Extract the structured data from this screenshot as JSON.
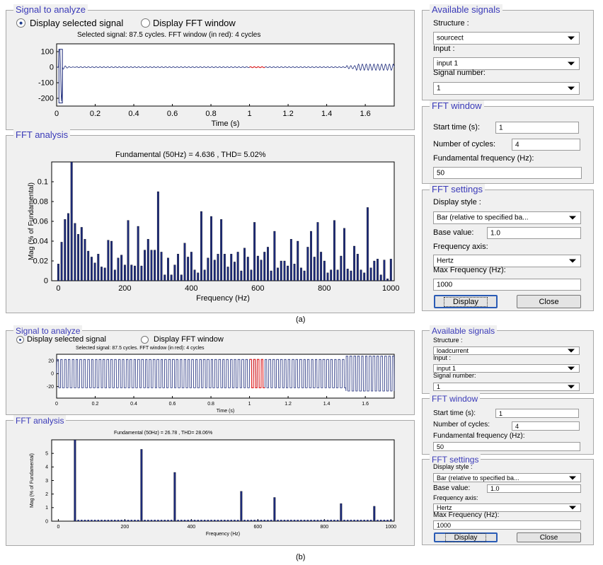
{
  "caption_a": "(a)",
  "caption_b": "(b)",
  "panels": [
    {
      "signal_group_title": "Signal to analyze",
      "radio_selected_label": "Display selected signal",
      "radio_fft_label": "Display FFT window",
      "signal_info": "Selected signal: 87.5 cycles. FFT window (in red): 4 cycles",
      "signal_plot": {
        "x_ticks": [
          "0",
          "0.2",
          "0.4",
          "0.6",
          "0.8",
          "1",
          "1.2",
          "1.4",
          "1.6"
        ],
        "y_ticks": [
          "100",
          "0",
          "-100",
          "-200"
        ],
        "xlabel": "Time (s)"
      },
      "fft_group_title": "FFT analysis",
      "fft_plot_title": "Fundamental (50Hz) = 4.636 , THD= 5.02%",
      "fft_plot": {
        "x_ticks": [
          "0",
          "200",
          "400",
          "600",
          "800",
          "1000"
        ],
        "y_ticks": [
          "0.1",
          "0.08",
          "0.06",
          "0.04",
          "0.02",
          "0"
        ],
        "xlabel": "Frequency (Hz)",
        "ylabel": "Mag (% of Fundamental)"
      },
      "available_title": "Available signals",
      "structure_label": "Structure :",
      "structure_value": "sourcect",
      "input_label": "Input :",
      "input_value": "input 1",
      "signal_number_label": "Signal number:",
      "signal_number_value": "1",
      "fft_window_title": "FFT window",
      "start_time_label": "Start time (s):",
      "start_time_value": "1",
      "cycles_label": "Number of cycles:",
      "cycles_value": "4",
      "fund_freq_label": "Fundamental frequency (Hz):",
      "fund_freq_value": "50",
      "fft_settings_title": "FFT settings",
      "display_style_label": "Display style :",
      "display_style_value": "Bar (relative to specified ba...",
      "base_value_label": "Base value:",
      "base_value_value": "1.0",
      "freq_axis_label": "Frequency axis:",
      "freq_axis_value": "Hertz",
      "max_freq_label": "Max Frequency (Hz):",
      "max_freq_value": "1000",
      "display_button": "Display",
      "close_button": "Close"
    },
    {
      "signal_group_title": "Signal to analyze",
      "radio_selected_label": "Display selected signal",
      "radio_fft_label": "Display FFT window",
      "signal_info": "Selected signal: 87.5 cycles. FFT window (in red): 4 cycles",
      "signal_plot": {
        "x_ticks": [
          "0",
          "0.2",
          "0.4",
          "0.6",
          "0.8",
          "1",
          "1.2",
          "1.4",
          "1.6"
        ],
        "y_ticks": [
          "20",
          "0",
          "-20"
        ],
        "xlabel": "Time (s)"
      },
      "fft_group_title": "FFT analysis",
      "fft_plot_title": "Fundamental (50Hz) = 26.78 , THD= 28.06%",
      "fft_plot": {
        "x_ticks": [
          "0",
          "200",
          "400",
          "600",
          "800",
          "1000"
        ],
        "y_ticks": [
          "5",
          "4",
          "3",
          "2",
          "1",
          "0"
        ],
        "xlabel": "Frequency (Hz)",
        "ylabel": "Mag (% of Fundamental)"
      },
      "available_title": "Available signals",
      "structure_label": "Structure :",
      "structure_value": "loadcurrent",
      "input_label": "Input :",
      "input_value": "input 1",
      "signal_number_label": "Signal number:",
      "signal_number_value": "1",
      "fft_window_title": "FFT window",
      "start_time_label": "Start time (s):",
      "start_time_value": "1",
      "cycles_label": "Number of cycles:",
      "cycles_value": "4",
      "fund_freq_label": "Fundamental frequency (Hz):",
      "fund_freq_value": "50",
      "fft_settings_title": "FFT settings",
      "display_style_label": "Display style :",
      "display_style_value": "Bar (relative to specified ba...",
      "base_value_label": "Base value:",
      "base_value_value": "1.0",
      "freq_axis_label": "Frequency axis:",
      "freq_axis_value": "Hertz",
      "max_freq_label": "Max Frequency (Hz):",
      "max_freq_value": "1000",
      "display_button": "Display",
      "close_button": "Close"
    }
  ],
  "chart_data": [
    {
      "type": "line",
      "title": "",
      "xlabel": "Time (s)",
      "ylabel": "",
      "xlim": [
        0,
        1.75
      ],
      "ylim": [
        -250,
        150
      ],
      "series": [
        {
          "color": "#1c2a7a",
          "x": [
            0,
            0.03,
            0.06,
            0.1,
            1.0,
            1.5,
            1.55,
            1.75
          ],
          "y": [
            0,
            110,
            0,
            3,
            2,
            5,
            20,
            15
          ]
        },
        {
          "color": "#e02020",
          "x": [
            1.0,
            1.08
          ],
          "y": [
            2,
            2
          ]
        }
      ]
    },
    {
      "type": "bar",
      "title": "Fundamental (50Hz) = 4.636 , THD= 5.02%",
      "xlabel": "Frequency (Hz)",
      "ylabel": "Mag (% of Fundamental)",
      "xlim": [
        -20,
        1010
      ],
      "ylim": [
        0,
        0.12
      ],
      "x": [
        0,
        10,
        20,
        30,
        40,
        50,
        60,
        70,
        80,
        90,
        100,
        110,
        120,
        130,
        140,
        150,
        160,
        170,
        180,
        190,
        200,
        210,
        220,
        230,
        240,
        250,
        260,
        270,
        280,
        290,
        300,
        310,
        320,
        330,
        340,
        350,
        360,
        370,
        380,
        390,
        400,
        410,
        420,
        430,
        440,
        450,
        460,
        470,
        480,
        490,
        500,
        510,
        520,
        530,
        540,
        550,
        560,
        570,
        580,
        590,
        600,
        610,
        620,
        630,
        640,
        650,
        660,
        670,
        680,
        690,
        700,
        710,
        720,
        730,
        740,
        750,
        760,
        770,
        780,
        790,
        800,
        810,
        820,
        830,
        840,
        850,
        860,
        870,
        880,
        890,
        900,
        910,
        920,
        930,
        940,
        950,
        960,
        970,
        980,
        990,
        1000
      ],
      "values": [
        0.017,
        0.039,
        0.062,
        0.068,
        0.12,
        0.058,
        0.047,
        0.054,
        0.042,
        0.03,
        0.024,
        0.018,
        0.027,
        0.014,
        0.013,
        0.041,
        0.04,
        0.011,
        0.023,
        0.026,
        0.016,
        0.061,
        0.016,
        0.015,
        0.055,
        0.015,
        0.031,
        0.042,
        0.031,
        0.031,
        0.09,
        0.029,
        0.006,
        0.023,
        0.006,
        0.016,
        0.027,
        0.006,
        0.038,
        0.024,
        0.029,
        0.011,
        0.008,
        0.07,
        0.011,
        0.023,
        0.065,
        0.021,
        0.027,
        0.062,
        0.027,
        0.014,
        0.027,
        0.019,
        0.029,
        0.01,
        0.033,
        0.024,
        0.011,
        0.059,
        0.025,
        0.021,
        0.029,
        0.034,
        0.01,
        0.05,
        0.013,
        0.02,
        0.02,
        0.015,
        0.042,
        0.017,
        0.04,
        0.013,
        0.01,
        0.034,
        0.05,
        0.024,
        0.059,
        0.029,
        0.02,
        0.008,
        0.011,
        0.061,
        0.011,
        0.025,
        0.053,
        0.012,
        0.01,
        0.035,
        0.027,
        0.011,
        0.008,
        0.074,
        0.013,
        0.02,
        0.022,
        0.006,
        0.021,
        0.002,
        0.022
      ],
      "color": "#1c2a7a"
    },
    {
      "type": "line",
      "title": "",
      "xlabel": "Time (s)",
      "ylabel": "",
      "xlim": [
        0,
        1.75
      ],
      "ylim": [
        -38,
        30
      ],
      "series": [
        {
          "color": "#1c2a7a",
          "x": [
            0,
            1.75
          ],
          "y": [
            -20,
            20
          ]
        },
        {
          "color": "#e02020",
          "x": [
            1.0,
            1.08
          ],
          "y": [
            -20,
            20
          ]
        }
      ]
    },
    {
      "type": "bar",
      "title": "Fundamental (50Hz) = 26.78 , THD= 28.06%",
      "xlabel": "Frequency (Hz)",
      "ylabel": "Mag (% of Fundamental)",
      "xlim": [
        -20,
        1010
      ],
      "ylim": [
        0,
        6
      ],
      "x": [
        50,
        250,
        350,
        550,
        650,
        850,
        950
      ],
      "values": [
        6.0,
        5.3,
        3.6,
        2.2,
        1.75,
        1.3,
        1.1
      ],
      "small_baseline_value": 0.1,
      "color": "#1c2a7a"
    }
  ]
}
